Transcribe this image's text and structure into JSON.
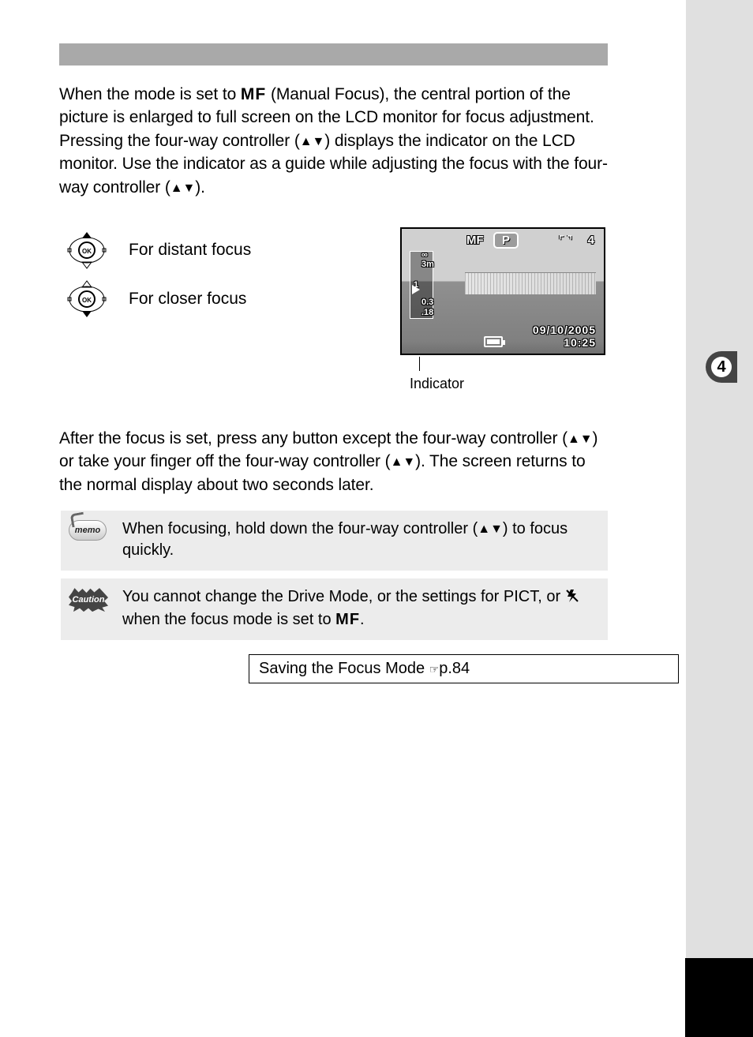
{
  "chapter_number": "4",
  "intro_paragraph_parts": {
    "p1a": "When the mode is set to ",
    "mf": "MF",
    "p1b": " (Manual Focus), the central portion of the picture is enlarged to full screen on the LCD monitor for focus adjustment. Pressing the four-way controller (",
    "arrows1": "▲▼",
    "p1c": ") displays the indicator on the LCD monitor. Use the indicator as a guide while adjusting the focus with the four-way controller (",
    "arrows2": "▲▼",
    "p1d": ")."
  },
  "distant_focus_label": "For distant focus",
  "closer_focus_label": "For closer focus",
  "indicator_label": "Indicator",
  "lcd": {
    "mf": "MF",
    "p": "P",
    "count": "4",
    "date": "09/10/2005",
    "time": "10:25",
    "scale": {
      "inf": "∞",
      "v3m": "3m",
      "v1": "1",
      "v03": "0.3",
      "v018": ".18"
    }
  },
  "after_paragraph": {
    "a": "After the focus is set, press any button except the four-way controller (",
    "arrows1": "▲▼",
    "b": ") or take your finger off the four-way controller (",
    "arrows2": "▲▼",
    "c": "). The screen returns to the normal display about two seconds later."
  },
  "memo": {
    "badge": "memo",
    "a": "When focusing, hold down the four-way controller (",
    "arrows": "▲▼",
    "b": ") to focus quickly."
  },
  "caution": {
    "badge": "Caution",
    "a": "You cannot change the Drive Mode, or the settings for PICT, or ",
    "b": " when the focus mode is set to ",
    "mf": "MF",
    "c": "."
  },
  "reference": {
    "text": "Saving the Focus Mode ",
    "page": "p.84"
  }
}
